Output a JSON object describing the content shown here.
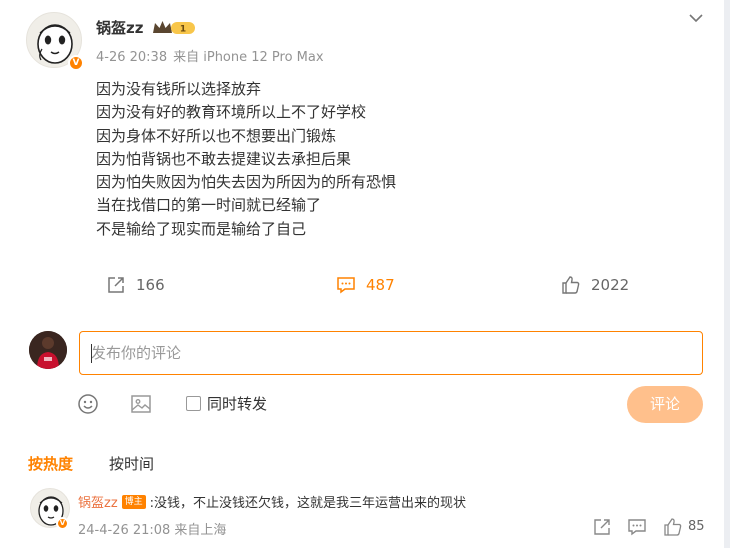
{
  "post": {
    "author": {
      "name": "锅盔zz",
      "vip_badge_text": "1",
      "verified_badge": "V"
    },
    "meta": {
      "date": "4-26 20:38",
      "source": "来自 iPhone 12 Pro Max"
    },
    "lines": [
      "因为没有钱所以选择放弃",
      "因为没有好的教育环境所以上不了好学校",
      "因为身体不好所以也不想要出门锻炼",
      "因为怕背锅也不敢去提建议去承担后果",
      "因为怕失败因为怕失去因为所因为的所有恐惧",
      "当在找借口的第一时间就已经输了",
      "不是输给了现实而是输给了自己"
    ],
    "actions": {
      "repost_count": "166",
      "comment_count": "487",
      "like_count": "2022"
    }
  },
  "composer": {
    "placeholder": "发布你的评论",
    "repost_label": "同时转发",
    "submit_label": "评论"
  },
  "sort": {
    "hot": "按热度",
    "time": "按时间"
  },
  "comments": [
    {
      "user": "锅盔zz",
      "tag": "博主",
      "text": ":没钱，不止没钱还欠钱，这就是我三年运营出来的现状",
      "date": "24-4-26 21:08",
      "location": "来自上海",
      "likes": "85"
    }
  ],
  "colors": {
    "accent": "#ff8200",
    "submit_disabled": "#ffc08c",
    "meta_gray": "#939393"
  },
  "icons": [
    "chevron-down-icon",
    "repost-icon",
    "comment-icon",
    "like-icon",
    "emoji-icon",
    "image-icon"
  ]
}
